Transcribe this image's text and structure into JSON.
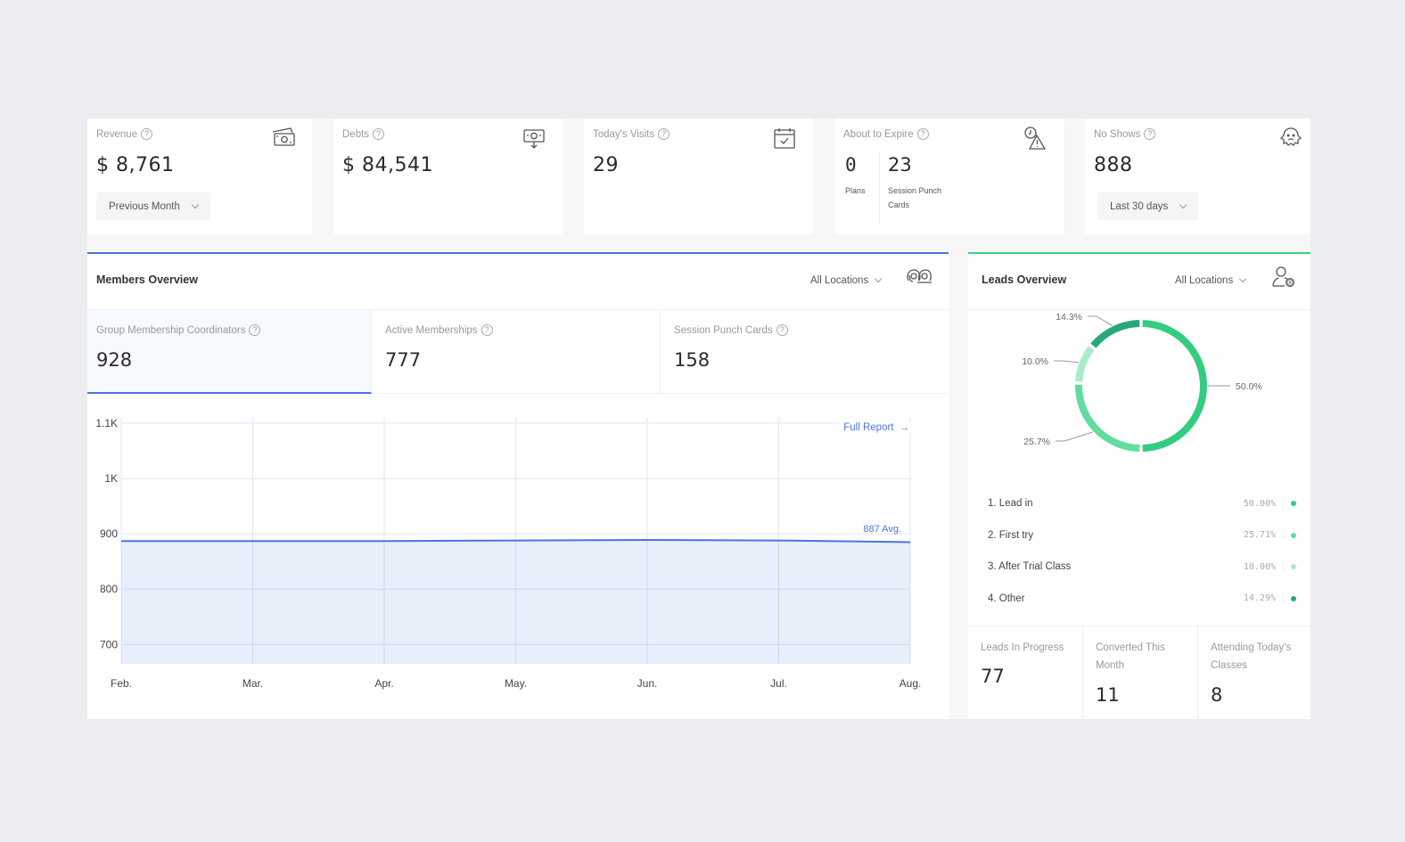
{
  "stats": {
    "revenue": {
      "title": "Revenue",
      "value": "$ 8,761",
      "dropdown": "Previous Month",
      "icon": "money-stack-icon"
    },
    "debts": {
      "title": "Debts",
      "value": "$ 84,541",
      "icon": "money-down-icon"
    },
    "visits": {
      "title": "Today's Visits",
      "value": "29",
      "icon": "calendar-check-icon"
    },
    "expire": {
      "title": "About to Expire",
      "plans_value": "0",
      "plans_label": "Plans",
      "cards_value": "23",
      "cards_label_1": "Session Punch",
      "cards_label_2": "Cards",
      "icon": "clock-warning-icon"
    },
    "noshows": {
      "title": "No Shows",
      "value": "888",
      "dropdown": "Last 30 days",
      "icon": "ghost-icon"
    }
  },
  "members": {
    "title": "Members Overview",
    "location": "All Locations",
    "kpis": [
      {
        "title": "Group Membership Coordinators",
        "value": "928"
      },
      {
        "title": "Active Memberships",
        "value": "777"
      },
      {
        "title": "Session Punch Cards",
        "value": "158"
      }
    ],
    "full_report": "Full Report",
    "accent": "#4a74e0"
  },
  "leads": {
    "title": "Leads Overview",
    "location": "All Locations",
    "legend": [
      {
        "label": "1. Lead in",
        "pct": "50.00%",
        "color": "#33cc80"
      },
      {
        "label": "2. First try",
        "pct": "25.71%",
        "color": "#62dca0"
      },
      {
        "label": "3. After Trial Class",
        "pct": "10.00%",
        "color": "#a8ecc9"
      },
      {
        "label": "4. Other",
        "pct": "14.29%",
        "color": "#28a87a"
      }
    ],
    "stats": [
      {
        "title_1": "Leads In Progress",
        "title_2": "",
        "value": "77"
      },
      {
        "title_1": "Converted This",
        "title_2": "Month",
        "value": "11"
      },
      {
        "title_1": "Attending Today's",
        "title_2": "Classes",
        "value": "8"
      }
    ],
    "accent": "#3ccf86"
  },
  "chart_data": [
    {
      "type": "area",
      "title": "Group Membership Coordinators",
      "x": [
        "Feb.",
        "Mar.",
        "Apr.",
        "May.",
        "Jun.",
        "Jul.",
        "Aug."
      ],
      "series": [
        {
          "name": "Group Membership Coordinators",
          "values": [
            887,
            887,
            887,
            888,
            889,
            888,
            885
          ]
        }
      ],
      "y_ticks": [
        "700",
        "800",
        "900",
        "1K",
        "1.1K"
      ],
      "y_tick_values": [
        700,
        800,
        900,
        1000,
        1100
      ],
      "ylim": [
        665,
        1100
      ],
      "avg_label": "887 Avg.",
      "grid": true
    },
    {
      "type": "pie",
      "style": "donut",
      "labels": [
        "Lead in",
        "First try",
        "After Trial Class",
        "Other"
      ],
      "values": [
        50.0,
        25.7,
        10.0,
        14.3
      ],
      "data_labels": [
        "50.0%",
        "25.7%",
        "10.0%",
        "14.3%"
      ],
      "colors": [
        "#33cc80",
        "#62dca0",
        "#a8ecc9",
        "#28a87a"
      ]
    }
  ]
}
